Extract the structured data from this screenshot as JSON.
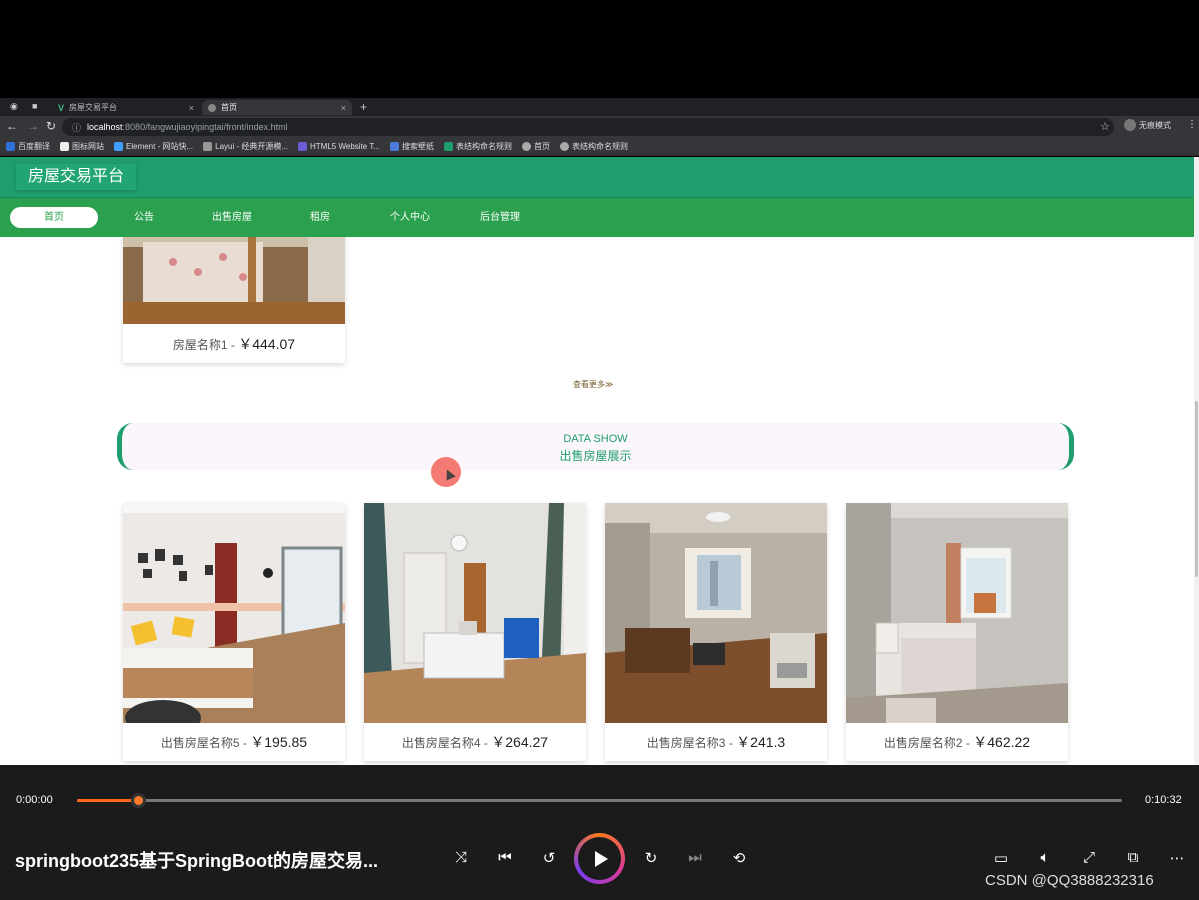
{
  "browser": {
    "tabs": [
      {
        "title": "房屋交易平台",
        "active": false
      },
      {
        "title": "首页",
        "active": true
      }
    ],
    "url_host": "localhost",
    "url_path": ":8080/fangwujiaoyipingtai/front/index.html",
    "profile_label": "无痕模式",
    "bookmarks": [
      "百度翻译",
      "图标网站",
      "Element - 网站快...",
      "Layui - 经典开源模...",
      "HTML5 Website T...",
      "搜索壁纸",
      "表结构命名规则",
      "首页",
      "表结构命名规则"
    ]
  },
  "site": {
    "title": "房屋交易平台",
    "nav": [
      "首页",
      "公告",
      "出售房屋",
      "租房",
      "个人中心",
      "后台管理"
    ],
    "active_nav": "首页"
  },
  "rental_section": {
    "items": [
      {
        "name": "房屋名称1",
        "sep": " - ",
        "price": "￥444.07"
      }
    ],
    "more_label": "查看更多≫"
  },
  "sale_section": {
    "banner_en": "DATA SHOW",
    "banner_cn": "出售房屋展示",
    "items": [
      {
        "name": "出售房屋名称5",
        "sep": " - ",
        "price": "￥195.85"
      },
      {
        "name": "出售房屋名称4",
        "sep": " - ",
        "price": "￥264.27"
      },
      {
        "name": "出售房屋名称3",
        "sep": " - ",
        "price": "￥241.3"
      },
      {
        "name": "出售房屋名称2",
        "sep": " - ",
        "price": "￥462.22"
      }
    ]
  },
  "player": {
    "current_time": "0:00:00",
    "total_time": "0:10:32",
    "progress": 0.058,
    "title": "springboot235基于SpringBoot的房屋交易...",
    "watermark": "CSDN @QQ3888232316",
    "accent": "#ff6a1a"
  },
  "colors": {
    "header_green": "#1f9d6e",
    "nav_green": "#2ba04e"
  }
}
